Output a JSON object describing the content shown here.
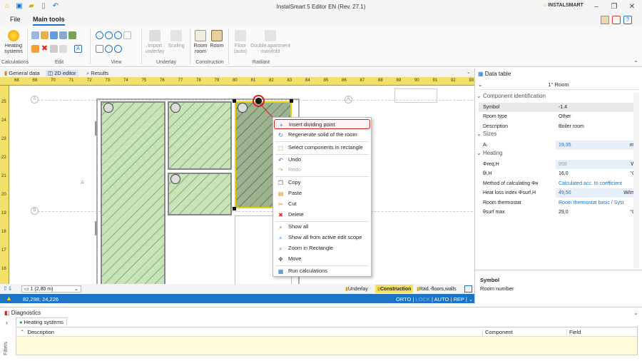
{
  "app": {
    "title": "InstalSmart 5 Editor EN (Rev. 27.1)",
    "brand": "INSTALSMART"
  },
  "menu": {
    "file": "File",
    "main_tools": "Main tools"
  },
  "ribbon": {
    "heating_systems": "Heating\nsystems",
    "import_underlay": "Import\nunderlay",
    "scaling": "Scaling",
    "room_room": "Room\nroom",
    "room": "Room",
    "floor_auto": "Floor\n(auto)",
    "double_apartment": "Double apartment\nmanifold",
    "groups": {
      "calculations": "Calculations",
      "edit": "Edit",
      "view": "View",
      "underlay": "Underlay",
      "construction": "Construction",
      "radiant": "Radiant"
    }
  },
  "doc_tabs": {
    "general": "General data",
    "editor": "2D editor",
    "results": "Results"
  },
  "ruler": {
    "h": [
      "68",
      "69",
      "70",
      "71",
      "72",
      "73",
      "74",
      "75",
      "76",
      "77",
      "78",
      "79",
      "80",
      "81",
      "82",
      "83",
      "84",
      "85",
      "86",
      "87",
      "88",
      "89",
      "90",
      "91",
      "92",
      "93"
    ],
    "v": [
      "25",
      "24",
      "23",
      "22",
      "21",
      "20",
      "19",
      "18",
      "17",
      "16"
    ]
  },
  "canvas": {
    "axis_left": "A",
    "axes": [
      "A",
      "A",
      "A",
      "A",
      "A",
      "A",
      "B",
      "B"
    ]
  },
  "context_menu": {
    "insert": "Insert dividing point",
    "regen": "Regenerate solid of the room",
    "select": "Select components in rectangle",
    "undo": "Undo",
    "redo": "Redo",
    "copy": "Copy",
    "paste": "Paste",
    "cut": "Cut",
    "delete": "Delete",
    "show_all": "Show all",
    "show_scope": "Show all from active edit scope",
    "zoom_rect": "Zoom in Rectangle",
    "move": "Move",
    "run": "Run calculations"
  },
  "statusbar": {
    "floor": "1 (2,80 m)",
    "underlay": "Underlay",
    "construction": "Construction",
    "rad": "Rad.-floors,walls"
  },
  "bluebar": {
    "coords": "82,298; 24,226",
    "orto": "ORTO",
    "lock": "LOCK",
    "auto": "AUTO",
    "rep": "REP"
  },
  "data_table": {
    "title": "Data table",
    "selection": "1° Room",
    "sec_component": "Component identification",
    "sec_sizes": "Sizes",
    "sec_heating": "Heating",
    "rows": [
      {
        "k": "Symbol",
        "v": "-1.4",
        "u": ""
      },
      {
        "k": "Room type",
        "v": "Other",
        "u": ""
      },
      {
        "k": "Description",
        "v": "Boiler room",
        "u": ""
      },
      {
        "k": "Aₗ",
        "v": "19,35",
        "u": "m²"
      },
      {
        "k": "Φreq,H",
        "v": "958",
        "u": "W"
      },
      {
        "k": "θi,H",
        "v": "16,0",
        "u": "°C"
      },
      {
        "k": "Method of calculating Φн",
        "v": "Calculated acc. to coefficient",
        "u": ""
      },
      {
        "k": "Heat loss index Φsurf,H",
        "v": "49,50",
        "u": "W/m²"
      },
      {
        "k": "Room thermostat",
        "v": "Room thermostat basic / Syst",
        "u": ""
      },
      {
        "k": "θsurf max",
        "v": "29,0",
        "u": "°C"
      }
    ],
    "help_title": "Symbol",
    "help_text": "Room number"
  },
  "diagnostics": {
    "title": "Diagnostics",
    "tab": "Heating systems",
    "col_desc": "Description",
    "col_comp": "Component",
    "col_field": "Field",
    "filters": "Filters"
  }
}
